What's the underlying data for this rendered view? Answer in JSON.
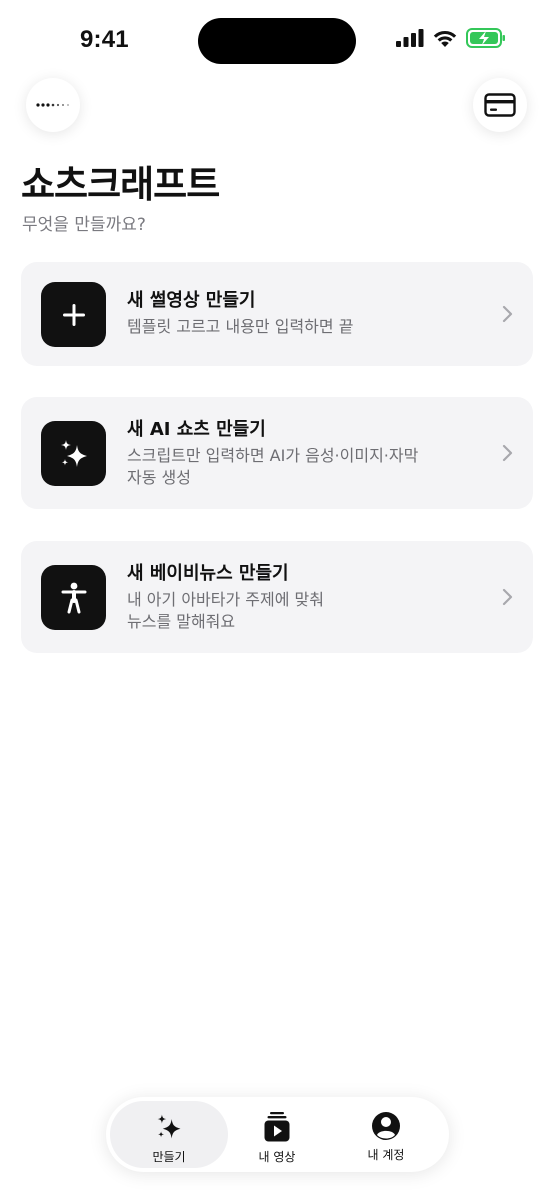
{
  "status_bar": {
    "time": "9:41"
  },
  "header": {
    "title": "쇼츠크래프트",
    "subtitle": "무엇을 만들까요?"
  },
  "top_buttons": {
    "left_icon": "dots-icon",
    "right_icon": "credit-card-icon"
  },
  "cards": [
    {
      "title": "새 썰영상 만들기",
      "description": "템플릿 고르고 내용만 입력하면 끝",
      "icon": "plus-icon"
    },
    {
      "title": "새 AI 쇼츠 만들기",
      "description": "스크립트만 입력하면 AI가 음성·이미지·자막\n자동 생성",
      "icon": "sparkles-icon"
    },
    {
      "title": "새 베이비뉴스 만들기",
      "description": "내 아기 아바타가 주제에 맞춰\n뉴스를 말해줘요",
      "icon": "person-icon"
    }
  ],
  "tab_bar": {
    "tabs": [
      {
        "label": "만들기",
        "icon": "sparkles-icon",
        "active": true
      },
      {
        "label": "내 영상",
        "icon": "video-library-icon",
        "active": false
      },
      {
        "label": "내 계정",
        "icon": "account-icon",
        "active": false
      }
    ]
  },
  "colors": {
    "battery_green": "#34c759",
    "card_bg": "#f4f4f6",
    "icon_bg": "#111111"
  }
}
